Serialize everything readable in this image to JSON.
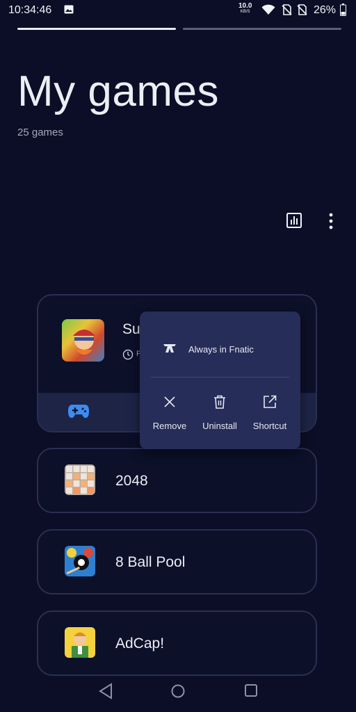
{
  "status_bar": {
    "time": "10:34:46",
    "net_speed_value": "10.0",
    "net_speed_unit": "KB/S",
    "battery": "26%"
  },
  "header": {
    "title": "My games",
    "count": "25 games"
  },
  "games": {
    "featured": {
      "name_visible": "Su",
      "playtime_visible": "F"
    },
    "list": [
      {
        "name": "2048",
        "icon": "game-2048-icon"
      },
      {
        "name": "8 Ball Pool",
        "icon": "game-8ball-icon"
      },
      {
        "name": "AdCap!",
        "icon": "game-adcap-icon"
      }
    ]
  },
  "popup": {
    "mode_label": "Always in Fnatic",
    "actions": [
      {
        "label": "Remove",
        "icon": "close-icon"
      },
      {
        "label": "Uninstall",
        "icon": "trash-icon"
      },
      {
        "label": "Shortcut",
        "icon": "external-link-icon"
      }
    ]
  },
  "colors": {
    "background": "#0b0e26",
    "accent_blue": "#3d8cf0",
    "popup_bg": "#262d58"
  }
}
